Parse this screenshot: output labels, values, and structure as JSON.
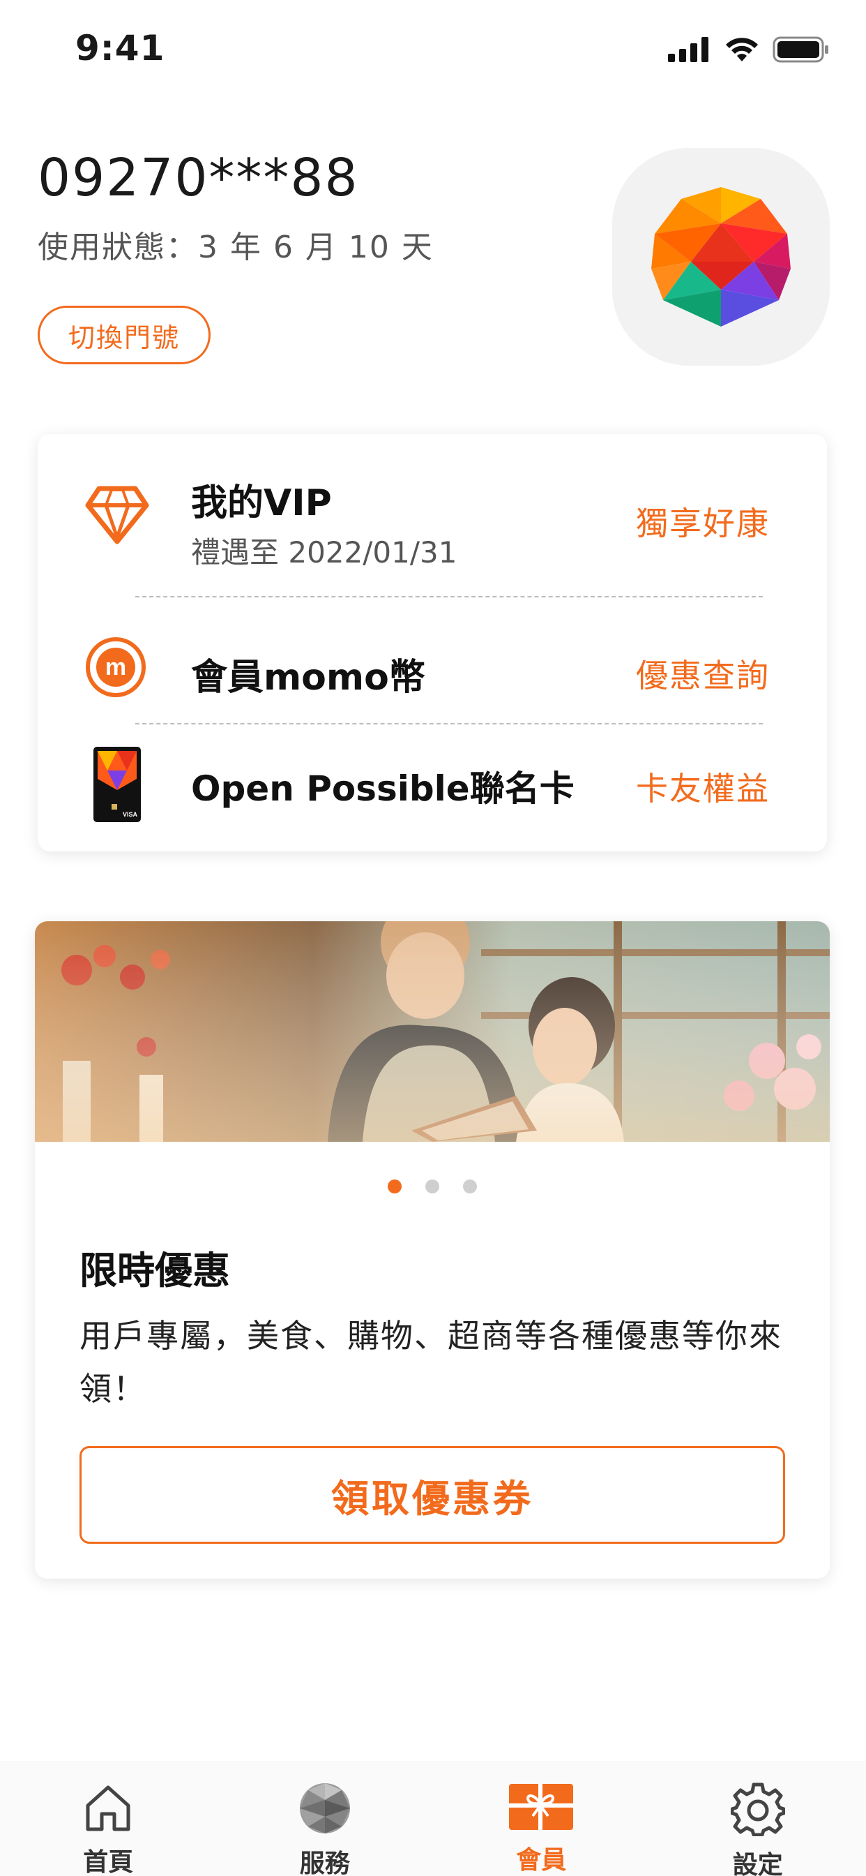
{
  "status_bar": {
    "time": "9:41"
  },
  "account": {
    "phone_number": "09270***88",
    "usage_status": "使用狀態：3 年 6 月 10 天",
    "switch_button": "切換門號"
  },
  "member_rows": [
    {
      "title": "我的VIP",
      "subtitle": "禮遇至 2022/01/31",
      "action": "獨享好康",
      "icon": "diamond-icon"
    },
    {
      "title": "會員momo幣",
      "action": "優惠查詢",
      "icon": "momo-coin-icon"
    },
    {
      "title": "Open Possible聯名卡",
      "action": "卡友權益",
      "icon": "credit-card-icon"
    }
  ],
  "promo": {
    "title": "限時優惠",
    "description": "用戶專屬，美食、購物、超商等各種優惠等你來領！",
    "button": "領取優惠券",
    "carousel_count": 3,
    "carousel_active": 0
  },
  "tabs": [
    {
      "label": "首頁",
      "icon": "home-icon"
    },
    {
      "label": "服務",
      "icon": "service-gem-icon"
    },
    {
      "label": "會員",
      "icon": "gift-card-icon",
      "active": true
    },
    {
      "label": "設定",
      "icon": "gear-icon"
    }
  ],
  "colors": {
    "accent": "#f26b1d",
    "text": "#1a1a1a",
    "muted": "#555555"
  }
}
